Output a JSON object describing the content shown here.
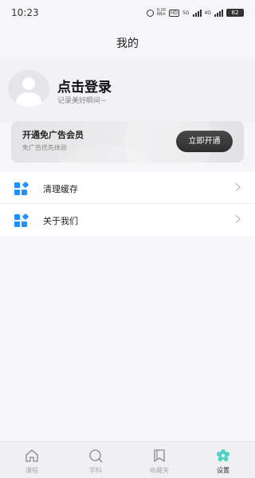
{
  "status_bar": {
    "time": "10:23",
    "small_text_top": "0.20",
    "small_text_bottom": "KB/s",
    "hd": "HD",
    "sig5g": "5G",
    "sig4g": "4G",
    "battery": "62"
  },
  "header": {
    "title": "我的"
  },
  "profile": {
    "login_text": "点击登录",
    "subtitle": "记录美好瞬间~"
  },
  "vip_card": {
    "title": "开通免广告会员",
    "description": "免广告优先体验",
    "button_label": "立即开通"
  },
  "menu": {
    "items": [
      {
        "label": "清理缓存",
        "icon": "apps-icon"
      },
      {
        "label": "关于我们",
        "icon": "apps-icon"
      }
    ]
  },
  "bottom_nav": {
    "items": [
      {
        "label": "课程",
        "icon": "home-icon",
        "active": false
      },
      {
        "label": "学科",
        "icon": "search-icon",
        "active": false
      },
      {
        "label": "收藏夹",
        "icon": "bookmark-icon",
        "active": false
      },
      {
        "label": "设置",
        "icon": "settings-flower-icon",
        "active": true
      }
    ]
  },
  "colors": {
    "accent_blue": "#1e90ff",
    "settings_teal": "#4fd1c5",
    "button_dark": "#333333"
  }
}
